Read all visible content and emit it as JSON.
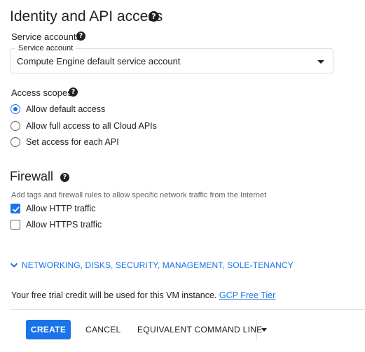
{
  "identity": {
    "title": "Identity and API access",
    "help_icon": "help-icon"
  },
  "service_accounts": {
    "label": "Service accounts",
    "field_label": "Service account",
    "value": "Compute Engine default service account"
  },
  "access_scopes": {
    "label": "Access scopes",
    "options": [
      {
        "label": "Allow default access",
        "selected": true
      },
      {
        "label": "Allow full access to all Cloud APIs",
        "selected": false
      },
      {
        "label": "Set access for each API",
        "selected": false
      }
    ]
  },
  "firewall": {
    "title": "Firewall",
    "hint": "Add tags and firewall rules to allow specific network traffic from the Internet",
    "options": [
      {
        "label": "Allow HTTP traffic",
        "checked": true
      },
      {
        "label": "Allow HTTPS traffic",
        "checked": false
      }
    ]
  },
  "more": {
    "label": "NETWORKING, DISKS, SECURITY, MANAGEMENT, SOLE-TENANCY",
    "icon": "chevron-down-icon"
  },
  "trial": {
    "text": "Your free trial credit will be used for this VM instance.",
    "link": "GCP Free Tier"
  },
  "actions": {
    "create": "CREATE",
    "cancel": "CANCEL",
    "command_line": "EQUIVALENT COMMAND LINE"
  },
  "colors": {
    "accent": "#1a73e8",
    "text": "#202124",
    "muted": "#5f6368"
  }
}
